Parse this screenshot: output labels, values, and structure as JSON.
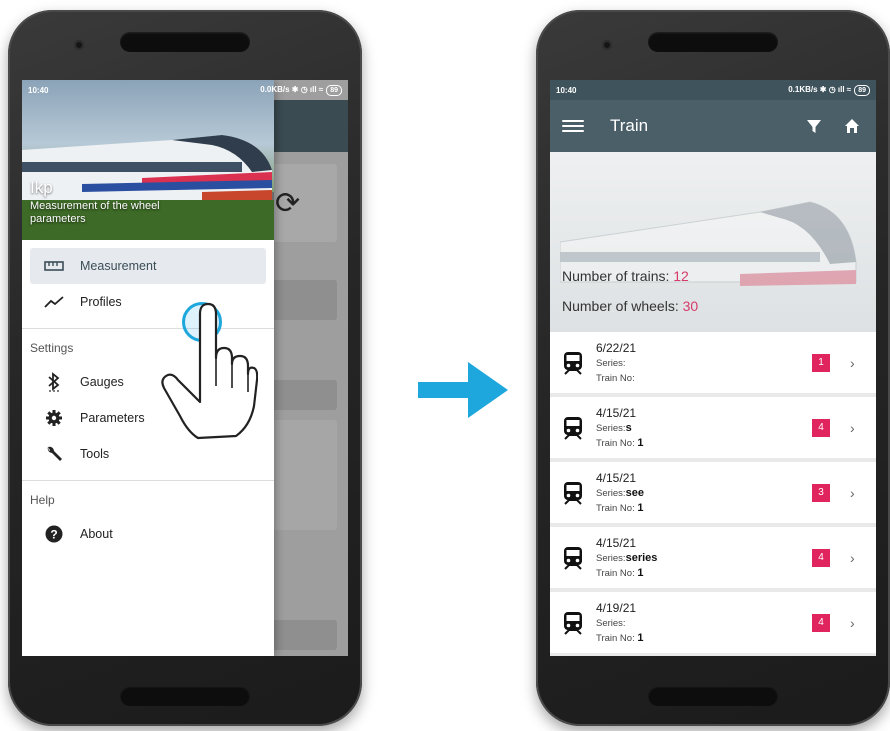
{
  "left": {
    "status": {
      "time": "10:40",
      "speed": "0.0KB/s",
      "battery": "89"
    },
    "drawer": {
      "app_title": "Ikp",
      "app_subtitle": "Measurement of the wheel parameters",
      "items": [
        {
          "label": "Measurement",
          "icon": "ruler-icon",
          "active": true
        },
        {
          "label": "Profiles",
          "icon": "trend-line-icon",
          "active": false
        }
      ],
      "settings_title": "Settings",
      "settings_items": [
        {
          "label": "Gauges",
          "icon": "bluetooth-icon"
        },
        {
          "label": "Parameters",
          "icon": "gear-icon"
        },
        {
          "label": "Tools",
          "icon": "wrench-icon"
        }
      ],
      "help_title": "Help",
      "help_items": [
        {
          "label": "About",
          "icon": "help-circle-icon"
        }
      ]
    }
  },
  "right": {
    "status": {
      "time": "10:40",
      "speed": "0.1KB/s",
      "battery": "89"
    },
    "appbar": {
      "title": "Train"
    },
    "hero": {
      "trains_label": "Number of trains:",
      "trains_value": "12",
      "wheels_label": "Number of wheels:",
      "wheels_value": "30"
    },
    "list": [
      {
        "date": "6/22/21",
        "series_label": "Series:",
        "series": "",
        "train_label": "Train No:",
        "train_no": "",
        "count": "1"
      },
      {
        "date": "4/15/21",
        "series_label": "Series:",
        "series": "s",
        "train_label": "Train No:",
        "train_no": "1",
        "count": "4"
      },
      {
        "date": "4/15/21",
        "series_label": "Series:",
        "series": "see",
        "train_label": "Train No:",
        "train_no": "1",
        "count": "3"
      },
      {
        "date": "4/15/21",
        "series_label": "Series:",
        "series": "series",
        "train_label": "Train No:",
        "train_no": "1",
        "count": "4"
      },
      {
        "date": "4/19/21",
        "series_label": "Series:",
        "series": "",
        "train_label": "Train No:",
        "train_no": "1",
        "count": "4"
      }
    ]
  },
  "colors": {
    "accent": "#e0245e",
    "appbar": "#4b5f68",
    "arrow": "#1ea7dd"
  }
}
